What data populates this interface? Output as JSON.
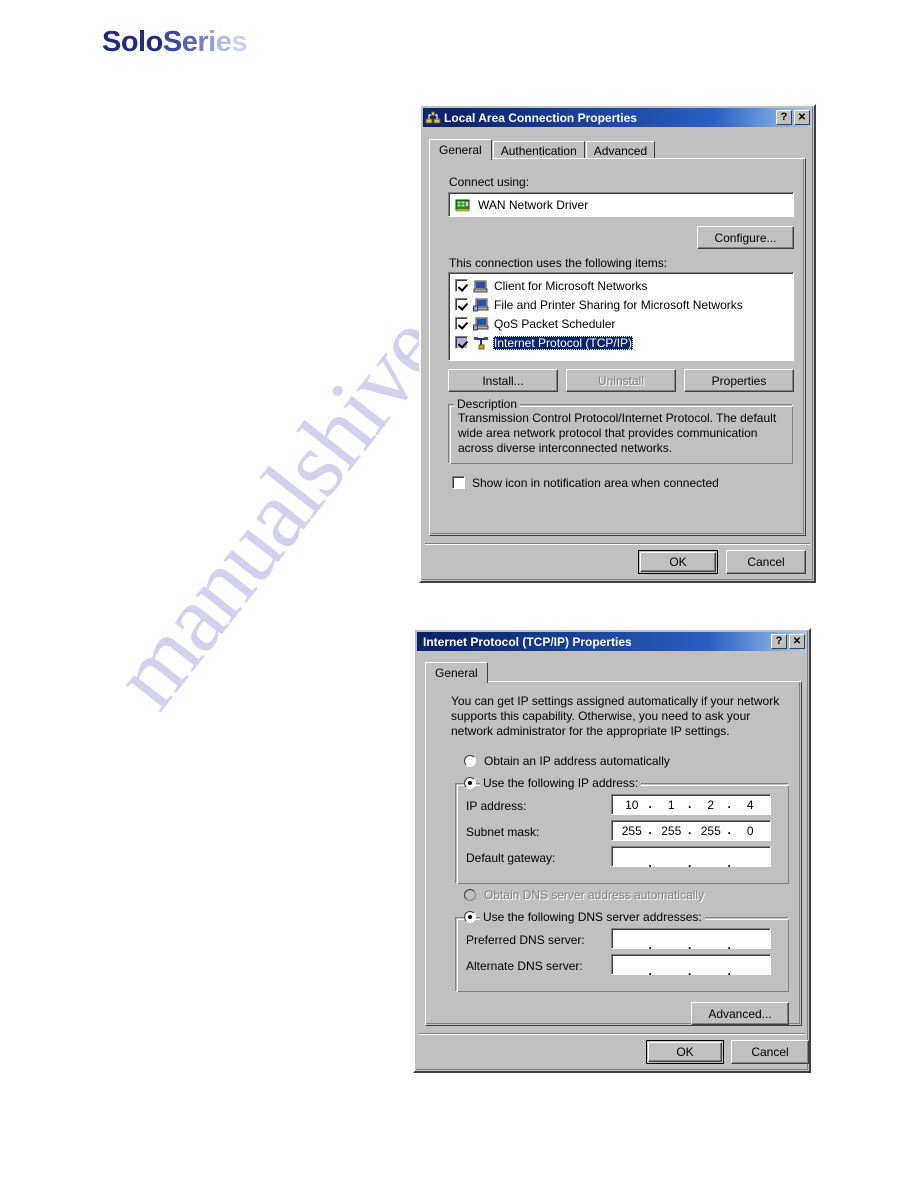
{
  "brand": {
    "part1": "Solo",
    "part2": "Series"
  },
  "watermark": {
    "text": "manualshive.com"
  },
  "dialog1": {
    "title": "Local Area Connection Properties",
    "titlebar_icon": "network-connection-icon",
    "help_button": "?",
    "close_button": "✕",
    "tabs": [
      {
        "label": "General",
        "active": true
      },
      {
        "label": "Authentication",
        "active": false
      },
      {
        "label": "Advanced",
        "active": false
      }
    ],
    "connect_using_label": "Connect using:",
    "adapter": {
      "name": "WAN Network Driver",
      "icon": "network-adapter-icon"
    },
    "configure_button": "Configure...",
    "items_label": "This connection uses the following items:",
    "items": [
      {
        "label": "Client for Microsoft Networks",
        "checked": true,
        "selected": false,
        "icon": "computer-icon"
      },
      {
        "label": "File and Printer Sharing for Microsoft Networks",
        "checked": true,
        "selected": false,
        "icon": "computer-icon"
      },
      {
        "label": "QoS Packet Scheduler",
        "checked": true,
        "selected": false,
        "icon": "computer-icon"
      },
      {
        "label": "Internet Protocol (TCP/IP)",
        "checked": true,
        "selected": true,
        "icon": "protocol-icon"
      }
    ],
    "install_button": "Install...",
    "uninstall_button": "Uninstall",
    "uninstall_disabled": true,
    "properties_button": "Properties",
    "description_group_title": "Description",
    "description_text": "Transmission Control Protocol/Internet Protocol. The default wide area network protocol that provides communication across diverse interconnected networks.",
    "show_icon_checkbox": {
      "label": "Show icon in notification area when connected",
      "checked": false
    },
    "ok_button": "OK",
    "cancel_button": "Cancel"
  },
  "dialog2": {
    "title": "Internet Protocol (TCP/IP) Properties",
    "help_button": "?",
    "close_button": "✕",
    "tabs": [
      {
        "label": "General",
        "active": true
      }
    ],
    "intro_text": "You can get IP settings assigned automatically if your network supports this capability. Otherwise, you need to ask your network administrator for the appropriate IP settings.",
    "radio_obtain_ip": {
      "label": "Obtain an IP address automatically",
      "selected": false
    },
    "radio_use_ip": {
      "label": "Use the following IP address:",
      "selected": true
    },
    "ip_address": {
      "label": "IP address:",
      "octets": [
        "10",
        "1",
        "2",
        "4"
      ]
    },
    "subnet_mask": {
      "label": "Subnet mask:",
      "octets": [
        "255",
        "255",
        "255",
        "0"
      ]
    },
    "default_gateway": {
      "label": "Default gateway:",
      "octets": [
        "",
        "",
        "",
        ""
      ]
    },
    "radio_obtain_dns": {
      "label": "Obtain DNS server address automatically",
      "selected": false,
      "disabled": true
    },
    "radio_use_dns": {
      "label": "Use the following DNS server addresses:",
      "selected": true
    },
    "preferred_dns": {
      "label": "Preferred DNS server:",
      "octets": [
        "",
        "",
        "",
        ""
      ]
    },
    "alternate_dns": {
      "label": "Alternate DNS server:",
      "octets": [
        "",
        "",
        "",
        ""
      ]
    },
    "advanced_button": "Advanced...",
    "ok_button": "OK",
    "cancel_button": "Cancel"
  }
}
